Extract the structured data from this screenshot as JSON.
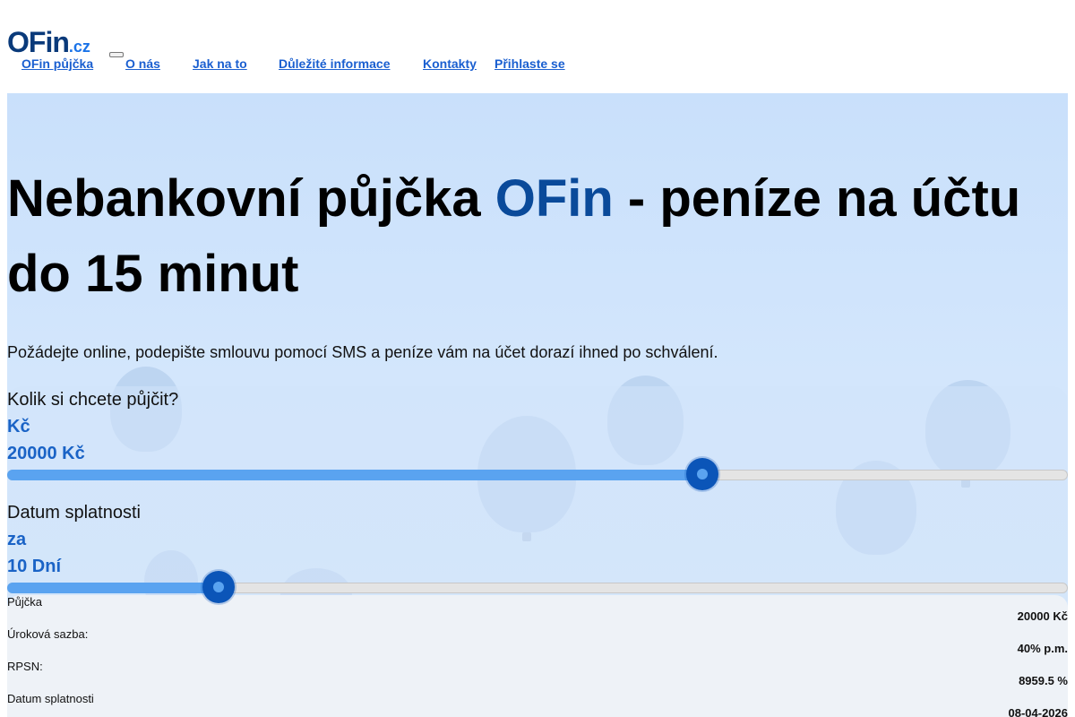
{
  "logo": {
    "main": "OFin",
    "tld": ".cz"
  },
  "nav": {
    "items": [
      {
        "label": "OFin půjčka"
      },
      {
        "label": "O nás"
      },
      {
        "label": "Jak na to"
      },
      {
        "label": "Důležité informace"
      },
      {
        "label": "Kontakty"
      },
      {
        "label": "Přihlaste se"
      }
    ]
  },
  "hero": {
    "title_part1": "Nebankovní půjčka ",
    "title_brand": "OFin",
    "title_part2": " - peníze na účtu do 15 minut",
    "subtitle": "Požádejte online, podepište smlouvu pomocí SMS a peníze vám na účet dorazí ihned po schválení."
  },
  "calculator": {
    "amount": {
      "question": "Kolik si chcete půjčit?",
      "unit": "Kč",
      "value_text": "20000 Kč",
      "level_fraction": 0.655
    },
    "due": {
      "question": "Datum splatnosti",
      "unit": "za",
      "value_text": "10 Dní",
      "level_fraction": 0.199
    }
  },
  "summary": {
    "rows": [
      {
        "label": "Půjčka",
        "value": "20000 Kč"
      },
      {
        "label": "Úroková sazba:",
        "value": "40% p.m."
      },
      {
        "label": "RPSN:",
        "value": "8959.5 %"
      },
      {
        "label": "Datum splatnosti",
        "value": "08-04-2026"
      }
    ]
  },
  "colors": {
    "accent": "#1a63c6",
    "brand_dark": "#0a4a9a",
    "slider_fill": "#5aa3f0",
    "hero_bg": "#c9e0fb"
  }
}
